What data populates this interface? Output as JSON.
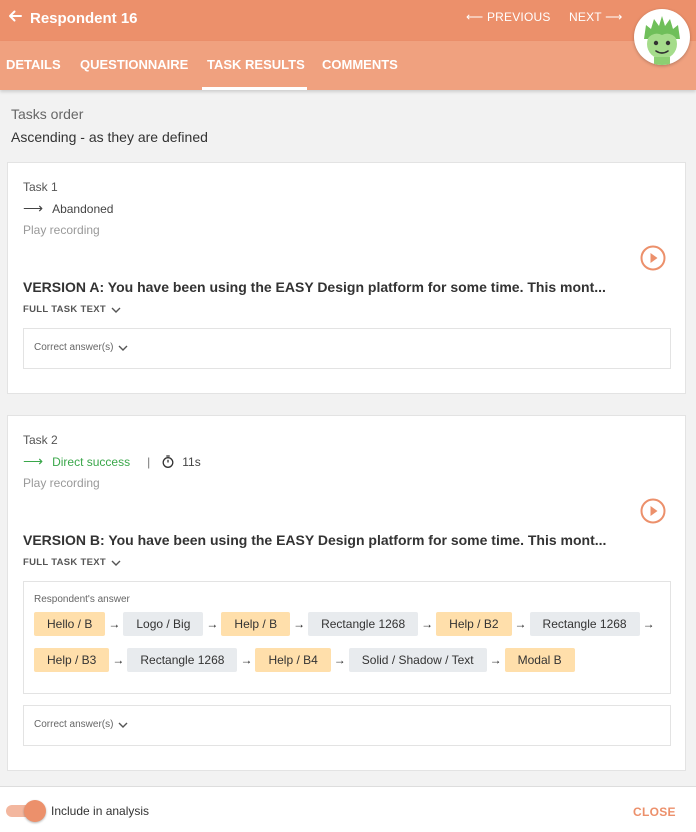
{
  "header": {
    "title": "Respondent 16",
    "previous_label": "PREVIOUS",
    "next_label": "NEXT",
    "back_icon": "arrow-left-icon",
    "accent_color": "#ec906b"
  },
  "tabs": [
    {
      "label": "DETAILS",
      "active": false
    },
    {
      "label": "QUESTIONNAIRE",
      "active": false
    },
    {
      "label": "TASK RESULTS",
      "active": true
    },
    {
      "label": "COMMENTS",
      "active": false
    }
  ],
  "tasks_order": {
    "label": "Tasks order",
    "value": "Ascending - as they are defined"
  },
  "tasks": [
    {
      "label": "Task 1",
      "status": "Abandoned",
      "play_recording": "Play recording",
      "version_text": "VERSION A: You have been using the EASY Design platform for some time. This mont...",
      "full_task_text": "FULL TASK TEXT",
      "correct_answers": "Correct answer(s)"
    },
    {
      "label": "Task 2",
      "status": "Direct success",
      "separator": "|",
      "time": "11s",
      "play_recording": "Play recording",
      "version_text": "VERSION B: You have been using the EASY Design platform for some time. This mont...",
      "full_task_text": "FULL TASK TEXT",
      "respondents_answer": "Respondent's answer",
      "path": [
        {
          "label": "Hello / B",
          "highlight": true
        },
        {
          "label": "Logo / Big",
          "highlight": false
        },
        {
          "label": "Help / B",
          "highlight": true
        },
        {
          "label": "Rectangle 1268",
          "highlight": false
        },
        {
          "label": "Help / B2",
          "highlight": true
        },
        {
          "label": "Rectangle 1268",
          "highlight": false
        },
        {
          "label": "Help / B3",
          "highlight": true
        },
        {
          "label": "Rectangle 1268",
          "highlight": false
        },
        {
          "label": "Help / B4",
          "highlight": true
        },
        {
          "label": "Solid / Shadow / Text",
          "highlight": false
        },
        {
          "label": "Modal B",
          "highlight": true
        }
      ],
      "correct_answers": "Correct answer(s)"
    }
  ],
  "footer": {
    "include_label": "Include in analysis",
    "include_enabled": true,
    "close_label": "CLOSE"
  }
}
